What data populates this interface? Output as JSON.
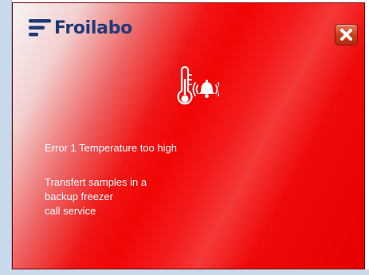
{
  "brand": {
    "name": "Froilabo",
    "logo_color": "#1f3b7a"
  },
  "alert": {
    "background_color": "#f20505",
    "icon": "thermometer-bell-alarm-icon",
    "error_message": "Error 1 Temperature too high",
    "instructions": [
      "Transfert samples in a",
      "backup freezer",
      "call service"
    ]
  },
  "close_button": {
    "icon": "close-icon",
    "color": "#c93a18"
  }
}
